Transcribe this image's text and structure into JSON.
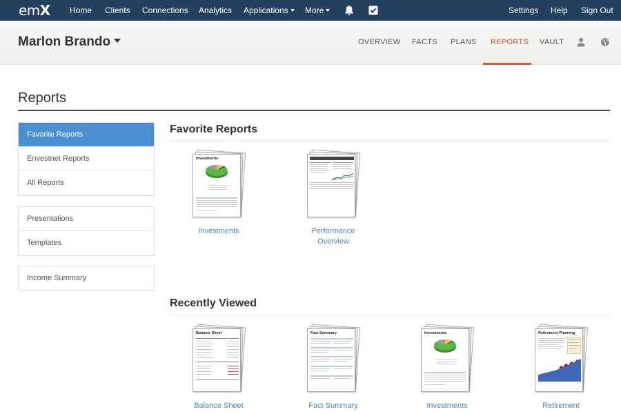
{
  "topnav": {
    "logo_left": "em",
    "logo_right": "X",
    "items": [
      {
        "label": "Home"
      },
      {
        "label": "Clients"
      },
      {
        "label": "Connections"
      },
      {
        "label": "Analytics"
      },
      {
        "label": "Applications"
      },
      {
        "label": "More"
      }
    ],
    "right_items": [
      {
        "label": "Settings"
      },
      {
        "label": "Help"
      },
      {
        "label": "Sign Out"
      }
    ],
    "icons": [
      "bell-icon",
      "checkbox-icon"
    ]
  },
  "client": {
    "name": "Marlon Brando",
    "tabs": [
      {
        "label": "OVERVIEW"
      },
      {
        "label": "FACTS"
      },
      {
        "label": "PLANS"
      },
      {
        "label": "REPORTS"
      },
      {
        "label": "VAULT"
      }
    ],
    "active_tab": "REPORTS",
    "icons": [
      "user-icon",
      "globe-icon"
    ]
  },
  "page": {
    "title": "Reports"
  },
  "sidebar": {
    "group1": [
      "Favorite Reports",
      "Envestnet Reports",
      "All Reports"
    ],
    "group2": [
      "Presentations",
      "Templates"
    ],
    "group3": [
      "Income Summary"
    ],
    "active": "Favorite Reports"
  },
  "favorites": {
    "title": "Favorite Reports",
    "items": [
      {
        "label": "Investments",
        "thumb_title": "Investments"
      },
      {
        "label": "Performance Overview",
        "label_line1": "Performance",
        "label_line2": "Overview"
      }
    ]
  },
  "recent": {
    "title": "Recently Viewed",
    "items": [
      {
        "label": "Balance Sheet",
        "thumb_title": "Balance Sheet"
      },
      {
        "label": "Fact Summary",
        "thumb_title": "Fact Summary"
      },
      {
        "label": "Investments",
        "thumb_title": "Investments"
      },
      {
        "label": "Retirement",
        "thumb_title": "Retirement Planning"
      }
    ]
  },
  "colors": {
    "topnav_bg": "#23405f",
    "accent_active_tab": "#d04f2f",
    "menu_active_bg": "#4a8fd1",
    "link": "#4a86c5"
  }
}
